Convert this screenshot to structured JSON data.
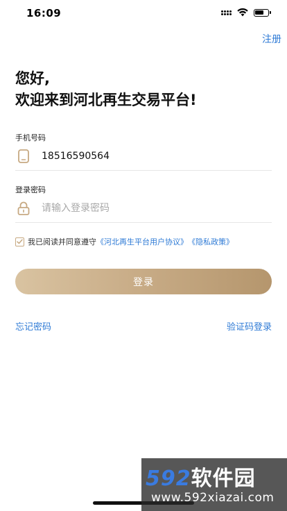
{
  "status_bar": {
    "time": "16:09",
    "battery_level": 0.75
  },
  "header": {
    "register_label": "注册"
  },
  "greeting": {
    "line1": "您好,",
    "line2": "欢迎来到河北再生交易平台!"
  },
  "phone_field": {
    "label": "手机号码",
    "value": "18516590564",
    "icon": "phone-icon"
  },
  "password_field": {
    "label": "登录密码",
    "placeholder": "请输入登录密码",
    "icon": "lock-icon"
  },
  "agreement": {
    "checked": true,
    "text": "我已阅读并同意遵守",
    "user_agreement_link": "《河北再生平台用户协议》",
    "privacy_link": "《隐私政策》"
  },
  "login_button": {
    "label": "登录"
  },
  "bottom_links": {
    "forgot_password": "忘记密码",
    "sms_login": "验证码登录"
  },
  "watermark": {
    "number": "592",
    "text": "软件园",
    "url": "www.592xiazai.com"
  },
  "colors": {
    "accent_link": "#2f7bd6",
    "gold_start": "#d9c3a1",
    "gold_end": "#b5966d",
    "icon_gold": "#c7a982"
  }
}
